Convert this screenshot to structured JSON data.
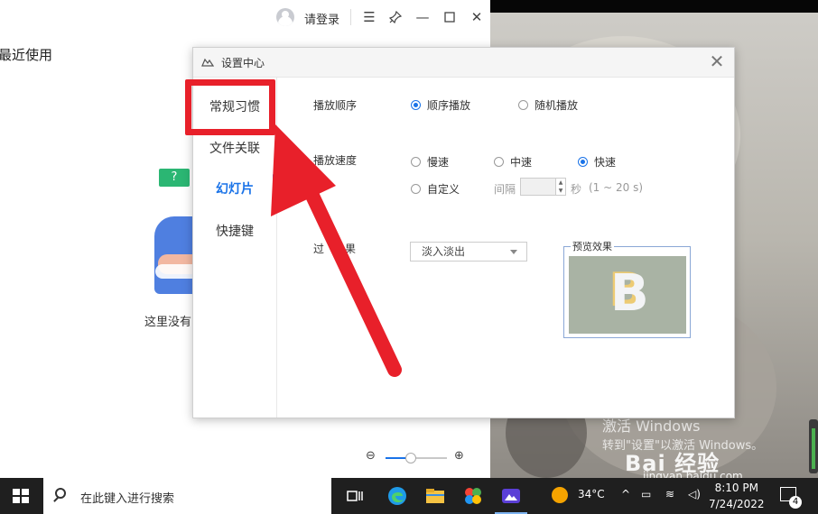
{
  "main_window": {
    "login_label": "请登录",
    "recent_label": "最近使用",
    "empty_text": "这里没有",
    "q_badge": "?"
  },
  "dialog": {
    "title": "设置中心",
    "sidebar": [
      {
        "label": "常规习惯",
        "active": false
      },
      {
        "label": "文件关联",
        "active": false
      },
      {
        "label": "幻灯片",
        "active": true
      },
      {
        "label": "快捷键",
        "active": false
      }
    ],
    "play_order": {
      "label": "播放顺序",
      "options": [
        {
          "label": "顺序播放",
          "selected": true
        },
        {
          "label": "随机播放",
          "selected": false
        }
      ]
    },
    "play_speed": {
      "label": "播放速度",
      "options": [
        {
          "label": "慢速",
          "selected": false
        },
        {
          "label": "中速",
          "selected": false
        },
        {
          "label": "快速",
          "selected": true
        },
        {
          "label": "自定义",
          "selected": false
        }
      ],
      "interval_label": "间隔",
      "unit_label": "秒",
      "range_label": "(1 ~ 20 s)"
    },
    "transition": {
      "label_visible": "过",
      "label_tail": "果",
      "select_value": "淡入淡出",
      "preview_label": "预览效果",
      "preview_letter": "B"
    }
  },
  "desktop": {
    "watermark_line1": "激活 Windows",
    "watermark_line2": "转到\"设置\"以激活 Windows。",
    "baidu_logo": "Bai  经验",
    "baidu_sub": "jingyan.baidu.com"
  },
  "taskbar": {
    "search_placeholder": "在此键入进行搜索",
    "weather": "34°C",
    "time": "8:10 PM",
    "date": "7/24/2022",
    "notification_count": "4"
  },
  "colors": {
    "accent": "#1a73e8",
    "annotation_red": "#e8202a"
  }
}
